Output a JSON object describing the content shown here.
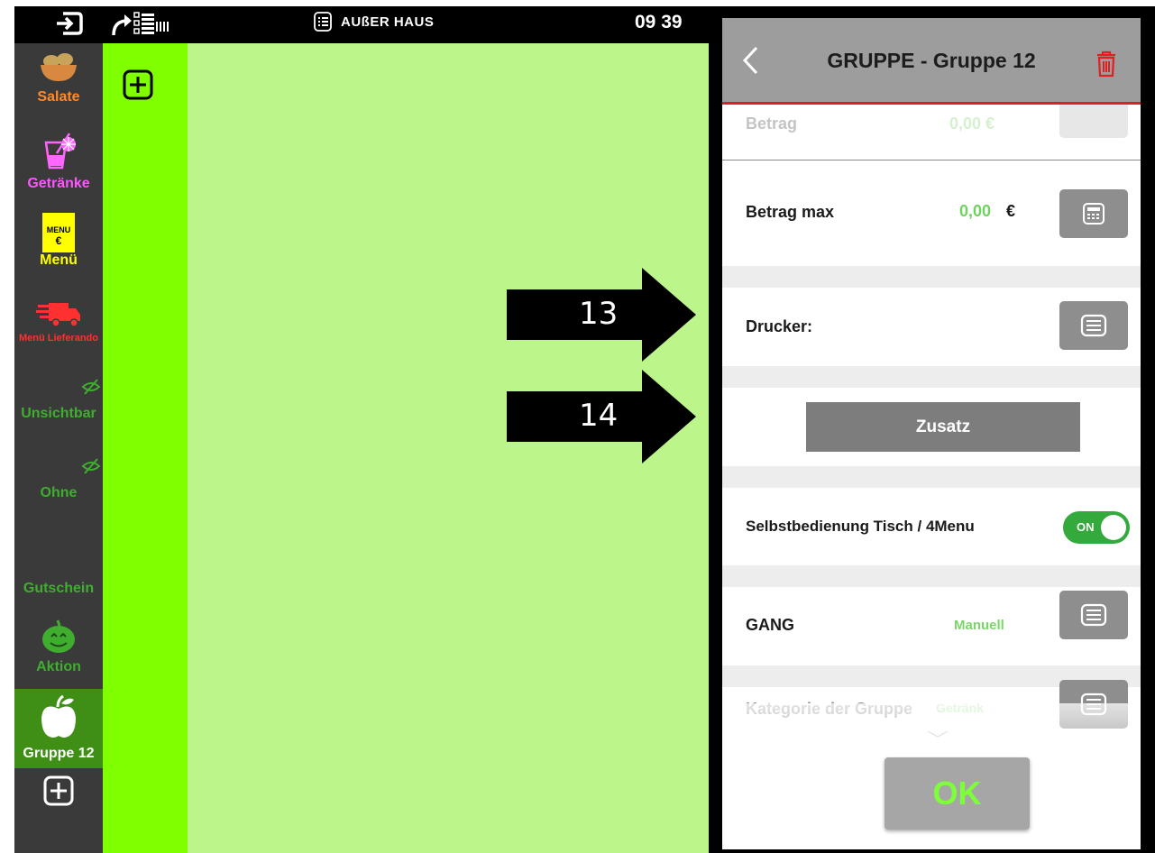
{
  "topbar": {
    "title": "AUßER HAUS",
    "clock": "09 39"
  },
  "sidebar": {
    "items": [
      {
        "label": "Salate",
        "color": "#ff8a2a"
      },
      {
        "label": "Getränke",
        "color": "#ff55ff"
      },
      {
        "label": "Menü",
        "color": "#ffff00"
      },
      {
        "label": "Menü Lieferando",
        "color": "#ff3030"
      },
      {
        "label": "Unsichtbar",
        "color": "#3fae2f"
      },
      {
        "label": "Ohne",
        "color": "#3fae2f"
      },
      {
        "label": "Gutschein",
        "color": "#3fae2f"
      },
      {
        "label": "Aktion",
        "color": "#3fae2f"
      },
      {
        "label": "Gruppe 12",
        "color": "#ffffff"
      }
    ],
    "menu_icon": {
      "line1": "MENU",
      "line2": "€"
    }
  },
  "annotations": {
    "arrow1": "13",
    "arrow2": "14"
  },
  "dialog": {
    "title": "GRUPPE - Gruppe 12",
    "rows": {
      "betrag_label": "Betrag",
      "betrag_value": "0,00 €",
      "betrag_max_label": "Betrag max",
      "betrag_max_value": "0,00",
      "currency": "€",
      "drucker_label": "Drucker:",
      "zusatz_label": "Zusatz",
      "selbst_label": "Selbstbedienung Tisch / 4Menu",
      "toggle_label": "ON",
      "gang_label": "GANG",
      "gang_value": "Manuell",
      "kategorie_label": "Kategorie der Gruppe",
      "kategorie_value": "Getränk"
    },
    "ok_label": "OK"
  }
}
